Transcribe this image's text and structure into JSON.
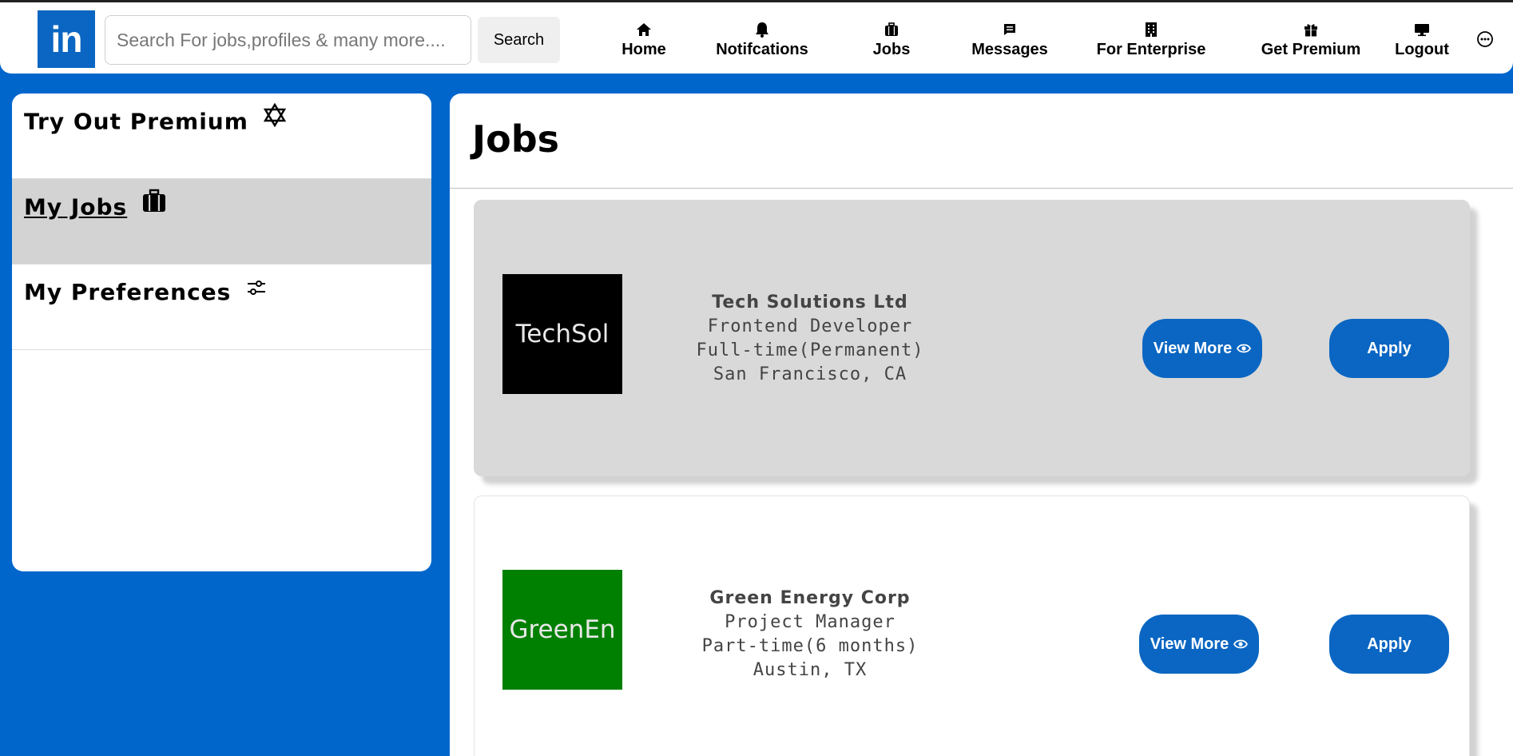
{
  "navbar": {
    "logo_text": "in",
    "search": {
      "placeholder": "Search For jobs,profiles & many more....",
      "value": ""
    },
    "search_button_label": "Search",
    "items": [
      {
        "label": "Home",
        "icon": "home-icon"
      },
      {
        "label": "Notifcations",
        "icon": "bell-icon"
      },
      {
        "label": "Jobs",
        "icon": "briefcase-icon"
      },
      {
        "label": "Messages",
        "icon": "message-icon"
      },
      {
        "label": "For Enterprise",
        "icon": "building-icon"
      },
      {
        "label": "Get Premium",
        "icon": "gift-icon"
      },
      {
        "label": "Logout",
        "icon": "monitor-icon"
      }
    ],
    "more_icon": "more-icon"
  },
  "sidebar": {
    "items": [
      {
        "label": "Try Out Premium",
        "icon": "star-of-david-icon",
        "active": false
      },
      {
        "label": "My Jobs",
        "icon": "briefcase-icon",
        "active": true
      },
      {
        "label": "My Preferences",
        "icon": "sliders-icon",
        "active": false
      }
    ]
  },
  "main": {
    "title": "Jobs",
    "jobs": [
      {
        "logo_text": "TechSol",
        "logo_color": "#000000",
        "company": "Tech Solutions Ltd",
        "role": "Frontend Developer",
        "type": "Full-time(Permanent)",
        "location": "San Francisco, CA",
        "view_more_label": "View More",
        "apply_label": "Apply",
        "highlighted": true
      },
      {
        "logo_text": "GreenEn",
        "logo_color": "#008000",
        "company": "Green Energy Corp",
        "role": "Project Manager",
        "type": "Part-time(6 months)",
        "location": "Austin, TX",
        "view_more_label": "View More",
        "apply_label": "Apply",
        "highlighted": false
      }
    ]
  },
  "colors": {
    "brand": "#0a66c2",
    "page_background": "#0066cc",
    "active_item": "#d3d3d3"
  }
}
